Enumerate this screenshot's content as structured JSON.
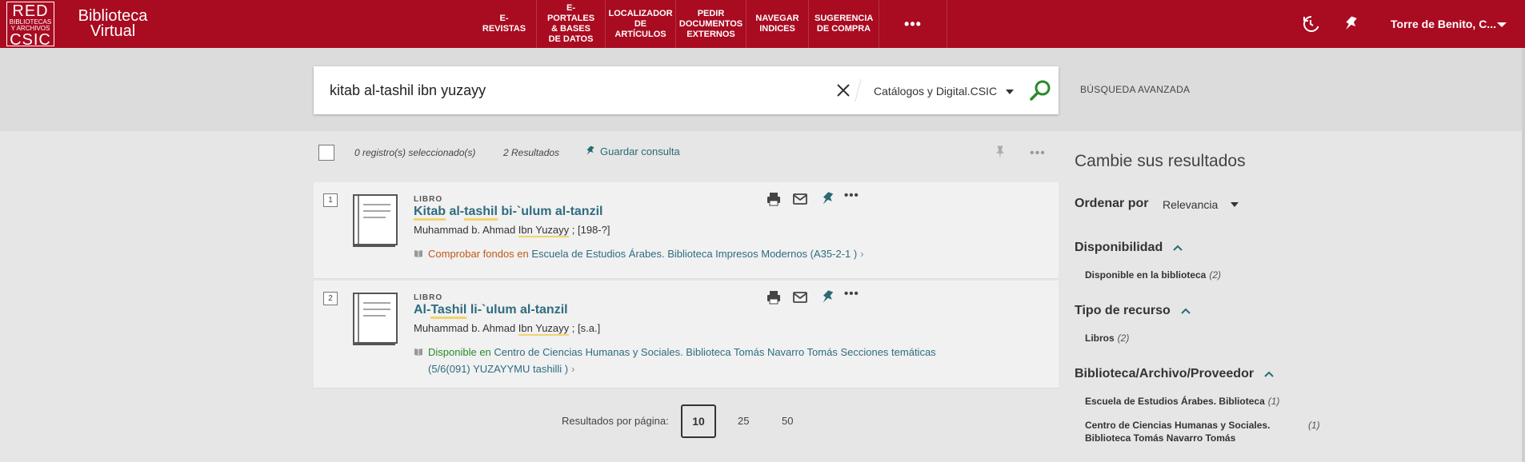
{
  "header": {
    "logo": {
      "line1": "RED",
      "line2": "BIBLIOTECAS",
      "line3": "Y ARCHIVOS",
      "line4": "CSIC"
    },
    "app_title_line1": "Biblioteca",
    "app_title_line2": "Virtual",
    "nav": [
      {
        "label": "E-REVISTAS"
      },
      {
        "label": "E-PORTALES & BASES DE DATOS"
      },
      {
        "label": "LOCALIZADOR DE ARTÍCULOS"
      },
      {
        "label": "PEDIR DOCUMENTOS EXTERNOS"
      },
      {
        "label": "NAVEGAR INDICES"
      },
      {
        "label": "SUGERENCIA DE COMPRA"
      },
      {
        "label": "•••"
      }
    ],
    "user": "Torre de Benito, C...",
    "icons": [
      "history-icon",
      "pin-icon",
      "chevron-down-icon"
    ]
  },
  "search": {
    "query": "kitab al-tashil ibn yuzayy",
    "scope": "Catálogos y Digital.CSIC",
    "advanced": "BÚSQUEDA AVANZADA"
  },
  "toolbar": {
    "selected": "0 registro(s) seleccionado(s)",
    "results": "2 Resultados",
    "save_query": "Guardar consulta",
    "more": "•••"
  },
  "results": [
    {
      "index": "1",
      "type": "LIBRO",
      "title_parts": [
        "Kitab",
        " al-",
        "tashil",
        " bi-`ulum al-tanzil"
      ],
      "author_pre": "Muhammad b. Ahmad ",
      "author_hl": "Ibn Yuzayy",
      "author_post": " ; [198-?]",
      "status": "Comprobar fondos en",
      "status_color": "#c2571a",
      "location": "Escuela de Estudios Árabes. Biblioteca  Impresos Modernos (A35-2-1 )",
      "location_line2": ""
    },
    {
      "index": "2",
      "type": "LIBRO",
      "title_parts": [
        "Al-",
        "Tashil",
        " li-`ulum al-tanzil"
      ],
      "author_pre": "Muhammad b. Ahmad ",
      "author_hl": "Ibn Yuzayy",
      "author_post": " ; [s.a.]",
      "status": "Disponible en",
      "status_color": "#2a8a2a",
      "location": "Centro de Ciencias Humanas y Sociales. Biblioteca Tomás Navarro Tomás  Secciones temáticas",
      "location_line2": "(5/6(091) YUZAYYMU tashilli )"
    }
  ],
  "pagination": {
    "label": "Resultados por página:",
    "options": [
      "10",
      "25",
      "50"
    ],
    "selected": "10"
  },
  "facets": {
    "title": "Cambie sus resultados",
    "sort_label": "Ordenar por",
    "sort_value": "Relevancia",
    "groups": [
      {
        "title": "Disponibilidad",
        "items": [
          {
            "label": "Disponible en la biblioteca",
            "count": "(2)"
          }
        ]
      },
      {
        "title": "Tipo de recurso",
        "items": [
          {
            "label": "Libros",
            "count": "(2)"
          }
        ]
      },
      {
        "title": "Biblioteca/Archivo/Proveedor",
        "items": [
          {
            "label": "Escuela de Estudios Árabes. Biblioteca",
            "count": "(1)"
          },
          {
            "label": "Centro de Ciencias Humanas y Sociales.",
            "label2": "Biblioteca Tomás Navarro Tomás",
            "count": "(1)"
          }
        ]
      }
    ]
  },
  "colors": {
    "brand": "#a90b21",
    "link": "#2e6c80",
    "highlight": "#f2d36b",
    "search_go": "#2a8a2a"
  }
}
